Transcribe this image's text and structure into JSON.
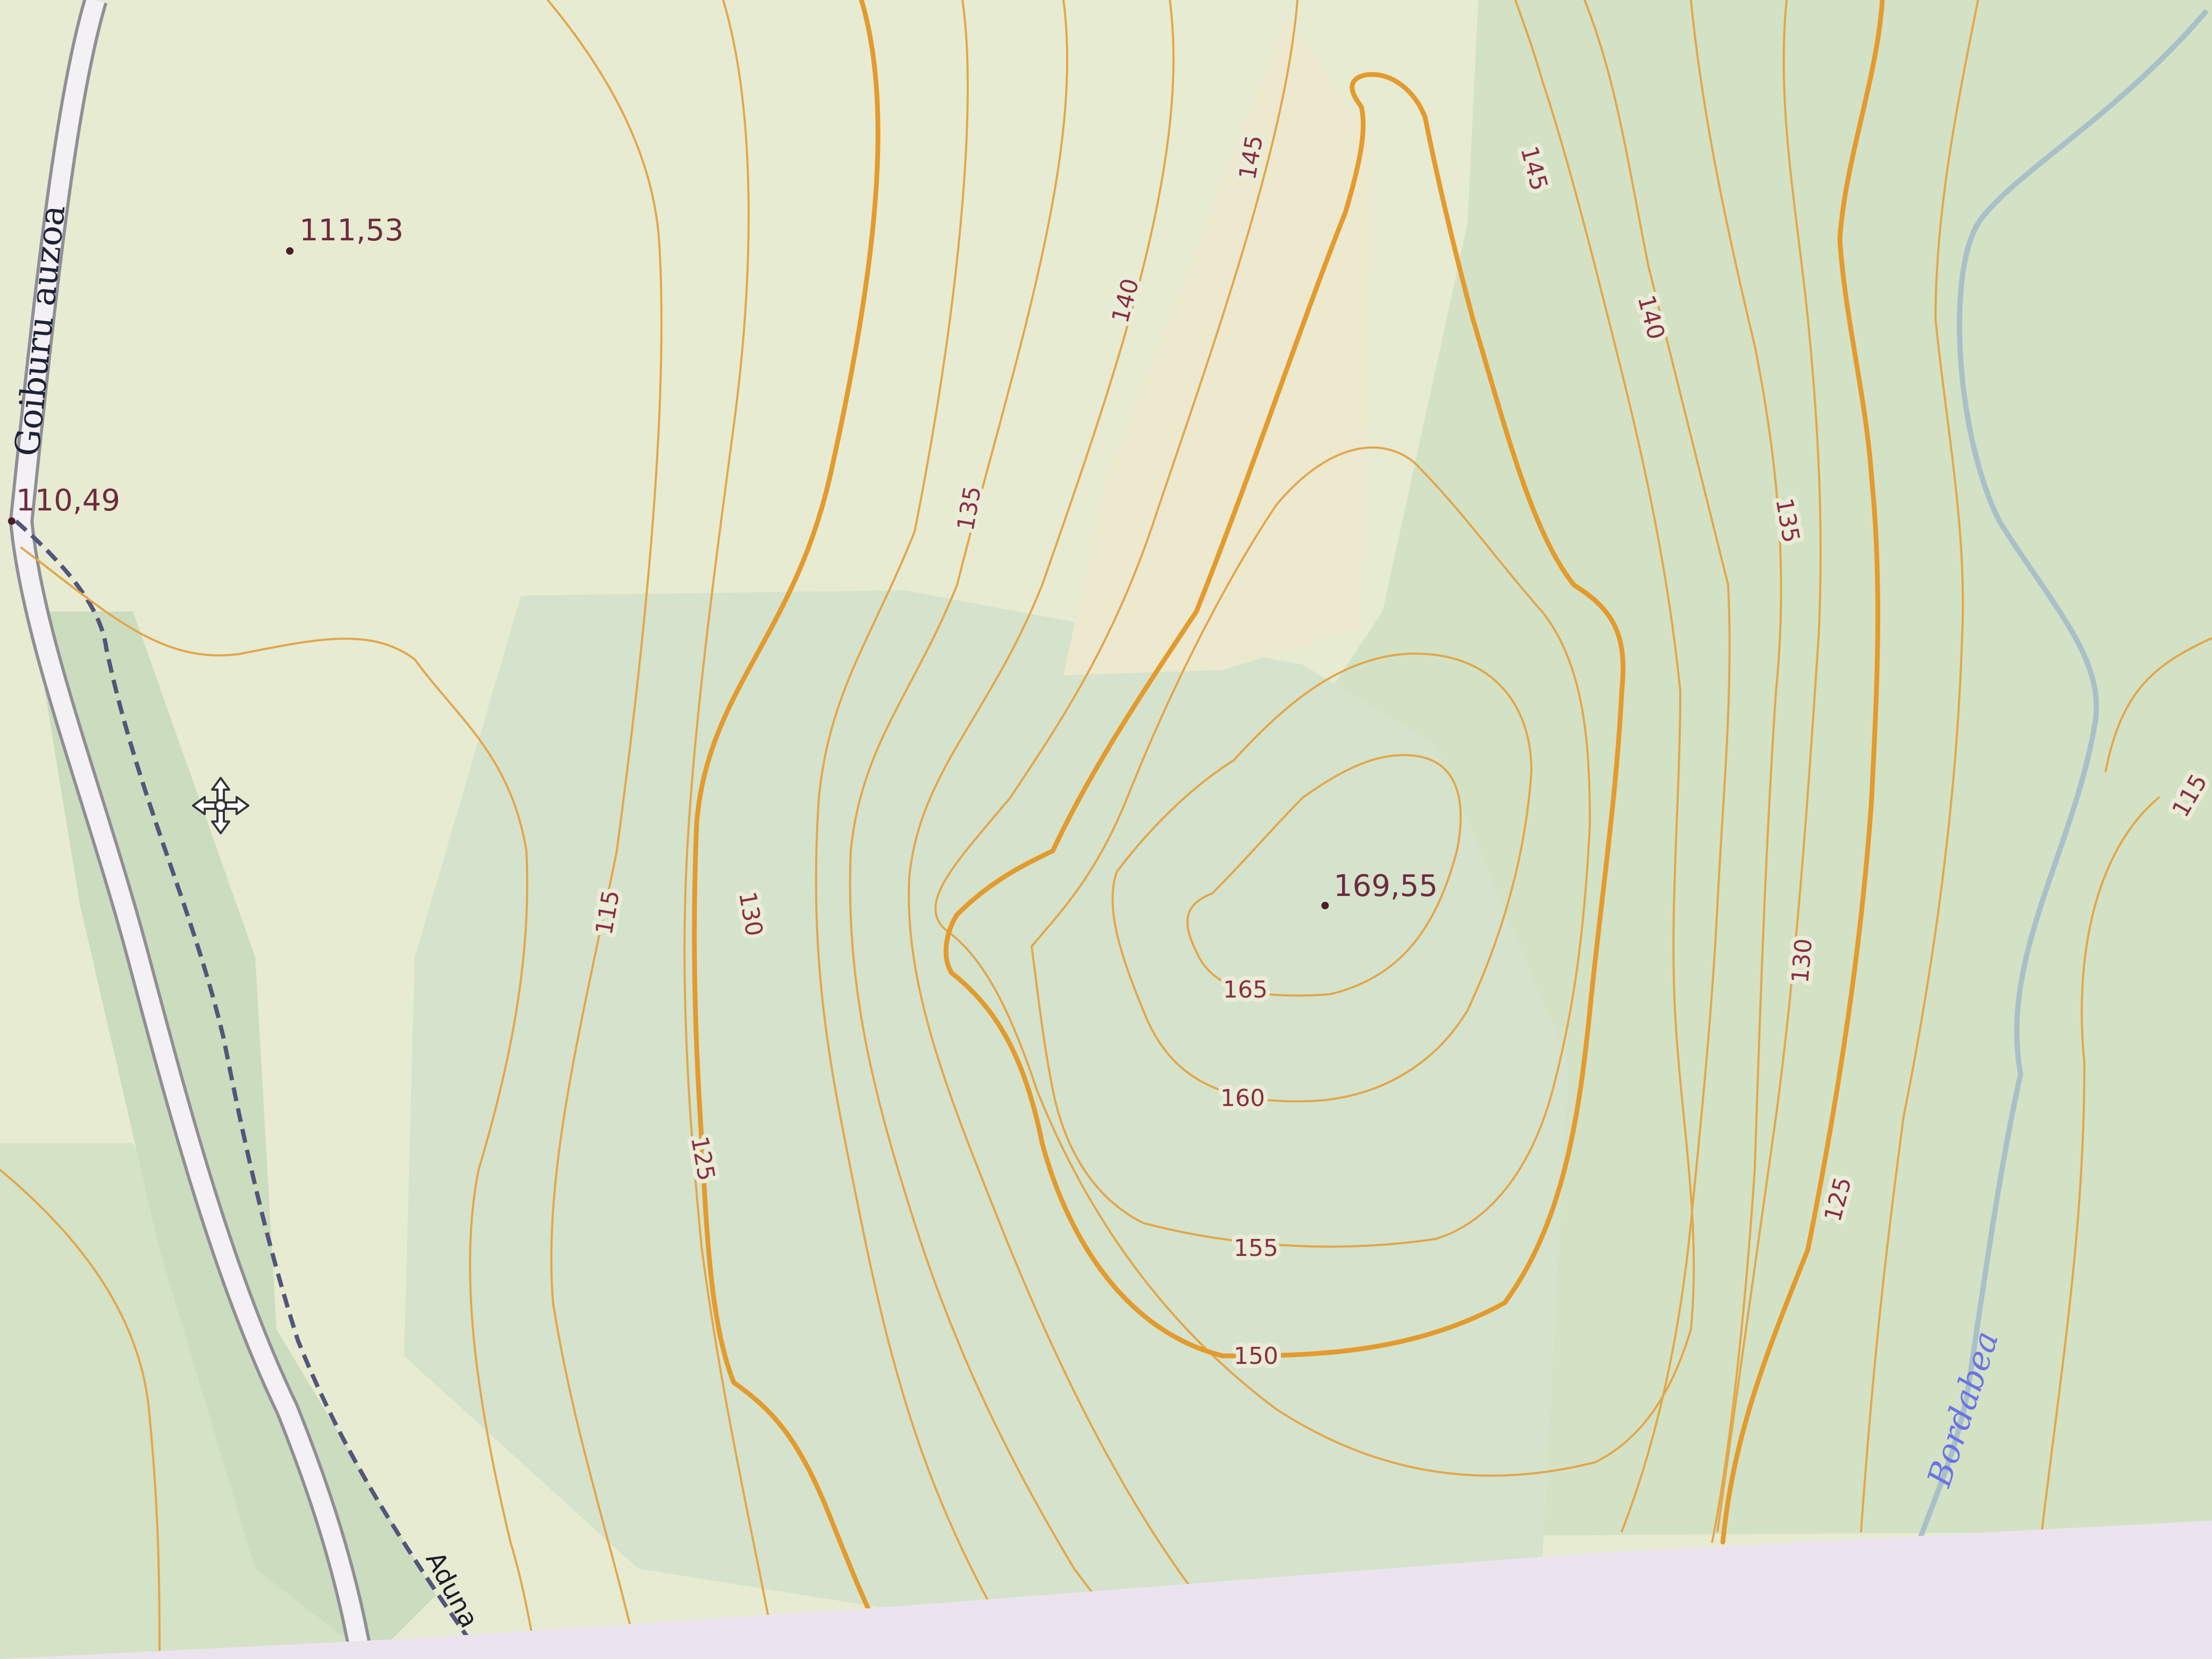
{
  "map": {
    "colors": {
      "background": "#e7ebd2",
      "forest": "#cfe0c6",
      "contour": "#e3a64a",
      "contour_index": "#e39b2e",
      "contour_label": "#8a2e44",
      "stream": "#a9c0c9",
      "stream_label": "#6b72e8",
      "road_fill": "#f4f1f4",
      "road_casing": "#8f8f95",
      "path": "#54557a"
    },
    "road_name": "Goiburu auzoa",
    "path_name": "Aduna",
    "stream_name": "Bordabea",
    "spot_heights": [
      "111,53",
      "110,49",
      "169,55"
    ],
    "contour_labels": [
      "115",
      "125",
      "130",
      "135",
      "140",
      "145",
      "145",
      "140",
      "135",
      "130",
      "125",
      "115",
      "165",
      "160",
      "155",
      "150"
    ],
    "cursor_icon": "move-cursor-icon"
  }
}
